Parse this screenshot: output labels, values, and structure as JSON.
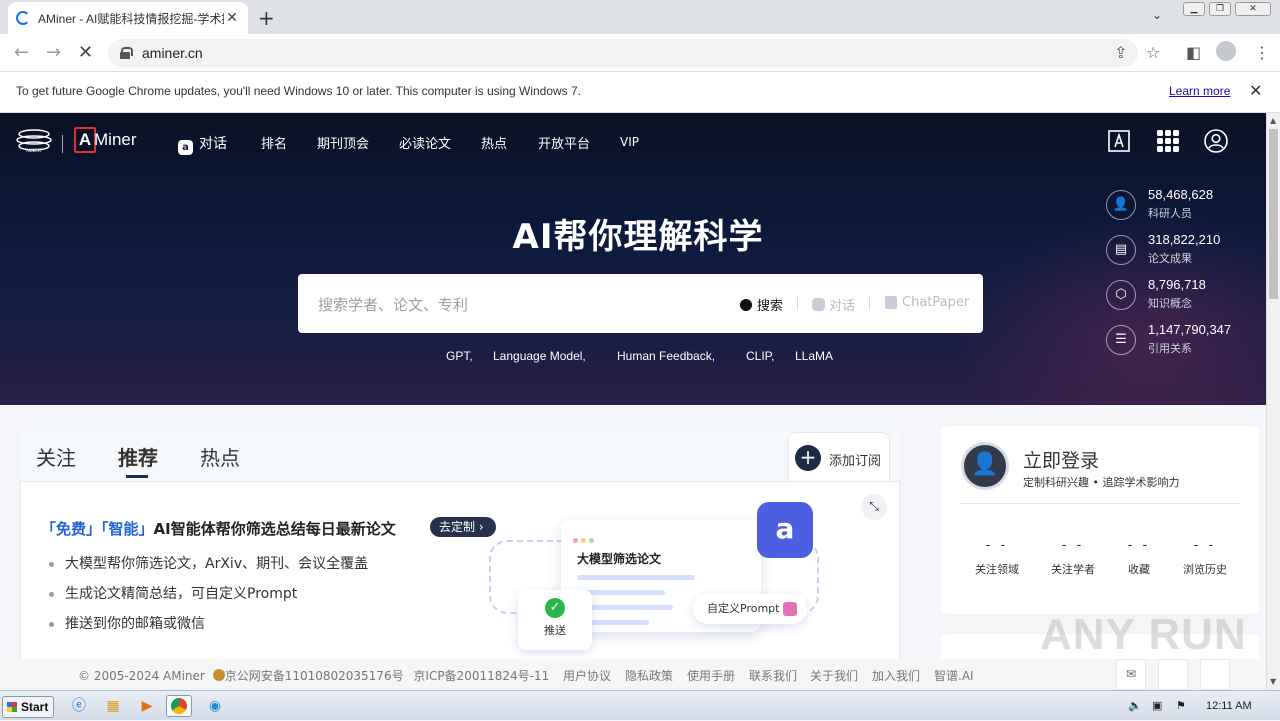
{
  "browser": {
    "tab_title": "AMiner - AI赋能科技情报挖掘-学术搜索",
    "url": "aminer.cn",
    "infobar_message": "To get future Google Chrome updates, you'll need Windows 10 or later. This computer is using Windows 7.",
    "infobar_link": "Learn more"
  },
  "header": {
    "logo_left": "AKNEST",
    "logo_text": "Miner",
    "logo_letter": "A",
    "nav": [
      "对话",
      "排名",
      "期刊顶会",
      "必读论文",
      "热点",
      "开放平台",
      "VIP"
    ]
  },
  "hero": {
    "title": "AI帮你理解科学",
    "search_placeholder": "搜索学者、论文、专利",
    "search_label": "搜索",
    "chat_label": "对话",
    "chatpaper_label": "ChatPaper",
    "suggestions": [
      "GPT,",
      "Language Model,",
      "Human Feedback,",
      "CLIP,",
      "LLaMA"
    ]
  },
  "stats": [
    {
      "value": "58,468,628",
      "label": "科研人员",
      "icon": "person-icon"
    },
    {
      "value": "318,822,210",
      "label": "论文成果",
      "icon": "document-icon"
    },
    {
      "value": "8,796,718",
      "label": "知识概念",
      "icon": "cube-icon"
    },
    {
      "value": "1,147,790,347",
      "label": "引用关系",
      "icon": "list-icon"
    }
  ],
  "feed": {
    "tabs": [
      "关注",
      "推荐",
      "热点"
    ],
    "active_tab": "推荐",
    "subscribe_label": "添加订阅",
    "promo_title_highlight": "「免费」「智能」",
    "promo_title_rest": "AI智能体帮你筛选总结每日最新论文",
    "promo_button": "去定制",
    "bullets": [
      "大模型帮你筛选论文，ArXiv、期刊、会议全覆盖",
      "生成论文精简总结，可自定义Prompt",
      "推送到你的邮箱或微信"
    ],
    "illustration": {
      "panel_title": "大模型筛选论文",
      "tag_label": "自定义Prompt",
      "push_label": "推送"
    }
  },
  "login": {
    "title": "立即登录",
    "subtitle": "定制科研兴趣 • 追踪学术影响力",
    "stats": [
      {
        "value": "- -",
        "label": "关注领域"
      },
      {
        "value": "- -",
        "label": "关注学者"
      },
      {
        "value": "- -",
        "label": "收藏"
      },
      {
        "value": "- -",
        "label": "浏览历史"
      }
    ]
  },
  "footer": {
    "copyright": "© 2005-2024 AMiner",
    "police_reg": "京公网安备11010802035176号",
    "icp": "京ICP备20011824号-11",
    "links": [
      "用户协议",
      "隐私政策",
      "使用手册",
      "联系我们",
      "关于我们",
      "加入我们",
      "智谱.AI"
    ]
  },
  "watermark": "ANY RUN",
  "taskbar": {
    "start_label": "Start",
    "clock": "12:11 AM"
  }
}
